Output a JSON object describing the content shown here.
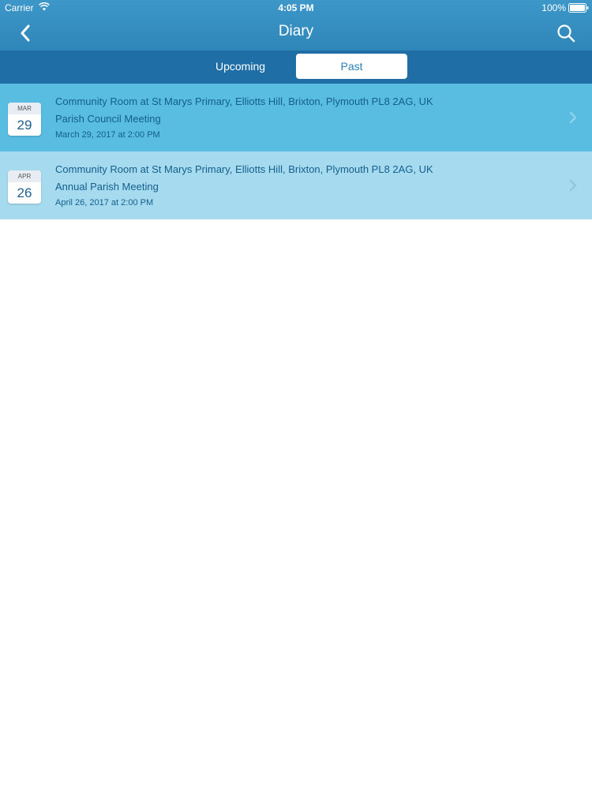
{
  "status_bar": {
    "carrier": "Carrier",
    "time": "4:05 PM",
    "battery": "100%"
  },
  "nav": {
    "title": "Diary",
    "back_icon": "chevron-left-icon",
    "search_icon": "search-icon"
  },
  "tabs": [
    {
      "label": "Upcoming",
      "selected": false
    },
    {
      "label": "Past",
      "selected": true
    }
  ],
  "events": [
    {
      "month": "MAR",
      "day": "29",
      "location": "Community Room at St Marys Primary, Elliotts Hill,  Brixton, Plymouth PL8 2AG, UK",
      "name": "Parish Council Meeting",
      "datetime": "March 29, 2017 at 2:00 PM"
    },
    {
      "month": "APR",
      "day": "26",
      "location": "Community Room at St Marys Primary, Elliotts Hill,  Brixton, Plymouth PL8 2AG, UK",
      "name": "Annual Parish Meeting",
      "datetime": "April 26, 2017 at 2:00 PM"
    }
  ],
  "colors": {
    "header": "#2f86b9",
    "segment_bar": "#1f6fa6",
    "row_primary": "#58bde1",
    "row_secondary": "#a6dbef",
    "text": "#145e8c"
  }
}
